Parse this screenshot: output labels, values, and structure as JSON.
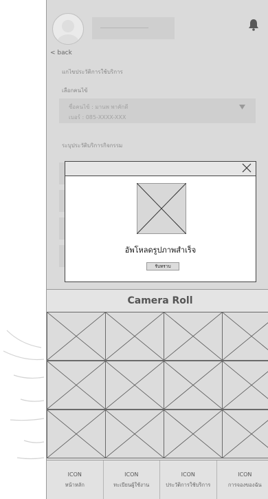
{
  "header": {
    "back_label": "< back"
  },
  "content": {
    "section_title": "แกไขประวัติการใช้บริการ",
    "select_label": "เลือกคนไข้",
    "select_line1": "ชื่อคนไข้ :   มานพ  พาคักดี",
    "select_line2": "เบอร์ :        085-XXXX-XXX",
    "activity_label": "ระบุประวัติบริการกิจกรรม"
  },
  "modal": {
    "title": "อัพโหลดรูปภาพสำเร็จ",
    "ok_label": "รับทราบ"
  },
  "camera": {
    "title": "Camera Roll"
  },
  "nav": {
    "items": [
      {
        "icon": "ICON",
        "label": "หน้าหลัก"
      },
      {
        "icon": "ICON",
        "label": "ทะเบียนผู้ใช้งาน"
      },
      {
        "icon": "ICON",
        "label": "ประวัติการใช้บริการ"
      },
      {
        "icon": "ICON",
        "label": "การจองของฉัน"
      }
    ]
  }
}
